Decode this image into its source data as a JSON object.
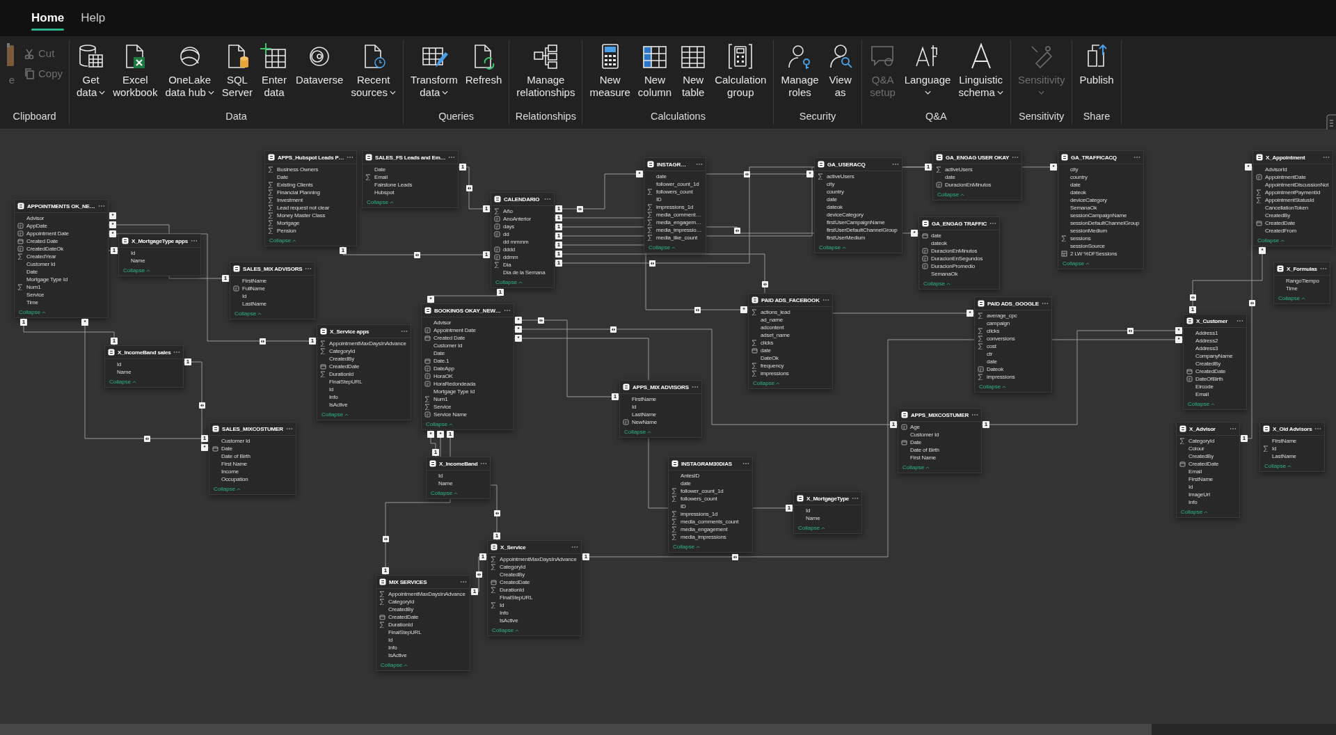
{
  "tabs": [
    {
      "label": "Home",
      "selected": true
    },
    {
      "label": "Help",
      "selected": false
    }
  ],
  "ribbon": {
    "groups": [
      {
        "label": "Clipboard",
        "buttons": [
          {
            "lines": [
              "e"
            ],
            "kind": "large",
            "dropdown": false,
            "disabled": true
          },
          {
            "lines": [
              "Cut"
            ],
            "kind": "small",
            "dropdown": false,
            "disabled": true
          },
          {
            "lines": [
              "Copy"
            ],
            "kind": "small",
            "dropdown": false,
            "disabled": true
          }
        ]
      },
      {
        "label": "Data",
        "buttons": [
          {
            "lines": [
              "Get",
              "data"
            ],
            "kind": "large",
            "dropdown": true,
            "disabled": false
          },
          {
            "lines": [
              "Excel",
              "workbook"
            ],
            "kind": "large",
            "dropdown": false,
            "disabled": false
          },
          {
            "lines": [
              "OneLake",
              "data hub"
            ],
            "kind": "large",
            "dropdown": true,
            "disabled": false
          },
          {
            "lines": [
              "SQL",
              "Server"
            ],
            "kind": "large",
            "dropdown": false,
            "disabled": false
          },
          {
            "lines": [
              "Enter",
              "data"
            ],
            "kind": "large",
            "dropdown": false,
            "disabled": false
          },
          {
            "lines": [
              "Dataverse"
            ],
            "kind": "large",
            "dropdown": false,
            "disabled": false
          },
          {
            "lines": [
              "Recent",
              "sources"
            ],
            "kind": "large",
            "dropdown": true,
            "disabled": false
          }
        ]
      },
      {
        "label": "Queries",
        "buttons": [
          {
            "lines": [
              "Transform",
              "data"
            ],
            "kind": "large",
            "dropdown": true,
            "disabled": false
          },
          {
            "lines": [
              "Refresh"
            ],
            "kind": "large",
            "dropdown": false,
            "disabled": false
          }
        ]
      },
      {
        "label": "Relationships",
        "buttons": [
          {
            "lines": [
              "Manage",
              "relationships"
            ],
            "kind": "large",
            "dropdown": false,
            "disabled": false
          }
        ]
      },
      {
        "label": "Calculations",
        "buttons": [
          {
            "lines": [
              "New",
              "measure"
            ],
            "kind": "large",
            "dropdown": false,
            "disabled": false
          },
          {
            "lines": [
              "New",
              "column"
            ],
            "kind": "large",
            "dropdown": false,
            "disabled": false
          },
          {
            "lines": [
              "New",
              "table"
            ],
            "kind": "large",
            "dropdown": false,
            "disabled": false
          },
          {
            "lines": [
              "Calculation",
              "group"
            ],
            "kind": "large",
            "dropdown": false,
            "disabled": false
          }
        ]
      },
      {
        "label": "Security",
        "buttons": [
          {
            "lines": [
              "Manage",
              "roles"
            ],
            "kind": "large",
            "dropdown": false,
            "disabled": false
          },
          {
            "lines": [
              "View",
              "as"
            ],
            "kind": "large",
            "dropdown": false,
            "disabled": false
          }
        ]
      },
      {
        "label": "Q&A",
        "buttons": [
          {
            "lines": [
              "Q&A",
              "setup"
            ],
            "kind": "large",
            "dropdown": false,
            "disabled": true
          },
          {
            "lines": [
              "Language"
            ],
            "kind": "large",
            "dropdown": true,
            "disabled": false
          },
          {
            "lines": [
              "Linguistic",
              "schema"
            ],
            "kind": "large",
            "dropdown": true,
            "disabled": false
          }
        ]
      },
      {
        "label": "Sensitivity",
        "buttons": [
          {
            "lines": [
              "Sensitivity"
            ],
            "kind": "large",
            "dropdown": true,
            "disabled": true
          }
        ]
      },
      {
        "label": "Share",
        "buttons": [
          {
            "lines": [
              "Publish"
            ],
            "kind": "large",
            "dropdown": false,
            "disabled": false
          }
        ]
      }
    ]
  },
  "model": {
    "tables": [
      {
        "name": "APPS_Hubspot Leads P…",
        "collapse_label": "Collapse",
        "fields": [
          {
            "name": "Business Owners",
            "kind": "sum"
          },
          {
            "name": "Date",
            "kind": "none"
          },
          {
            "name": "Existing Clients",
            "kind": "sum"
          },
          {
            "name": "Financial Planning",
            "kind": "sum"
          },
          {
            "name": "Investment",
            "kind": "sum"
          },
          {
            "name": "Lead request not clear",
            "kind": "sum"
          },
          {
            "name": "Money Master Class",
            "kind": "sum"
          },
          {
            "name": "Mortgage",
            "kind": "sum"
          },
          {
            "name": "Pension",
            "kind": "sum"
          }
        ]
      },
      {
        "name": "SALES_FS Leads and Em…",
        "collapse_label": "Collapse",
        "fields": [
          {
            "name": "Date",
            "kind": "none"
          },
          {
            "name": "Email",
            "kind": "sum"
          },
          {
            "name": "Fairstone Leads",
            "kind": "none"
          },
          {
            "name": "Hubspot",
            "kind": "none"
          }
        ]
      },
      {
        "name": "INSTAGR…",
        "collapse_label": "Collapse",
        "fields": [
          {
            "name": "date",
            "kind": "none"
          },
          {
            "name": "follower_count_1d",
            "kind": "none"
          },
          {
            "name": "followers_count",
            "kind": "sum"
          },
          {
            "name": "ID",
            "kind": "none"
          },
          {
            "name": "impressions_1d",
            "kind": "sum"
          },
          {
            "name": "media_comment…",
            "kind": "sum"
          },
          {
            "name": "media_engagem…",
            "kind": "sum"
          },
          {
            "name": "media_impressio…",
            "kind": "sum"
          },
          {
            "name": "media_like_count",
            "kind": "sum"
          }
        ]
      },
      {
        "name": "GA_USERACQ",
        "collapse_label": "Collapse",
        "fields": [
          {
            "name": "activeUsers",
            "kind": "sum"
          },
          {
            "name": "city",
            "kind": "none"
          },
          {
            "name": "country",
            "kind": "none"
          },
          {
            "name": "date",
            "kind": "none"
          },
          {
            "name": "dateok",
            "kind": "none"
          },
          {
            "name": "deviceCategory",
            "kind": "none"
          },
          {
            "name": "firstUserCampaignName",
            "kind": "none"
          },
          {
            "name": "firstUserDefaultChannelGroup",
            "kind": "none"
          },
          {
            "name": "firstUserMedium",
            "kind": "none"
          }
        ]
      },
      {
        "name": "GA_ENGAG USER OKAY",
        "collapse_label": "Collapse",
        "fields": [
          {
            "name": "activeUsers",
            "kind": "sum"
          },
          {
            "name": "date",
            "kind": "none"
          },
          {
            "name": "DuracionEnMinutos",
            "kind": "calc"
          }
        ]
      },
      {
        "name": "GA_TRAFFICACQ",
        "collapse_label": "Collapse",
        "fields": [
          {
            "name": "city",
            "kind": "none"
          },
          {
            "name": "country",
            "kind": "none"
          },
          {
            "name": "date",
            "kind": "none"
          },
          {
            "name": "dateok",
            "kind": "none"
          },
          {
            "name": "deviceCategory",
            "kind": "none"
          },
          {
            "name": "SemanaOk",
            "kind": "none"
          },
          {
            "name": "sessionCampaignName",
            "kind": "none"
          },
          {
            "name": "sessionDefaultChannelGroup",
            "kind": "none"
          },
          {
            "name": "sessionMedium",
            "kind": "none"
          },
          {
            "name": "sessions",
            "kind": "sum"
          },
          {
            "name": "sessionSource",
            "kind": "none"
          },
          {
            "name": "2 LW %DFSessions",
            "kind": "table"
          }
        ]
      },
      {
        "name": "X_Appointment",
        "collapse_label": "Collapse",
        "fields": [
          {
            "name": "AdvisorId",
            "kind": "none"
          },
          {
            "name": "AppointmentDate",
            "kind": "calc"
          },
          {
            "name": "AppointmentDiscussionNot",
            "kind": "none"
          },
          {
            "name": "AppointmentPaymentId",
            "kind": "sum"
          },
          {
            "name": "AppointmentStatusId",
            "kind": "sum"
          },
          {
            "name": "CancellationToken",
            "kind": "none"
          },
          {
            "name": "CreatedBy",
            "kind": "none"
          },
          {
            "name": "CreatedDate",
            "kind": "date"
          },
          {
            "name": "CreatedFrom",
            "kind": "none"
          }
        ]
      },
      {
        "name": "APPOINTMENTS OK_NE…",
        "collapse_label": "Collapse",
        "fields": [
          {
            "name": "Advisor",
            "kind": "none"
          },
          {
            "name": "AppDate",
            "kind": "calc"
          },
          {
            "name": "Appointment Date",
            "kind": "calc"
          },
          {
            "name": "Created Date",
            "kind": "date"
          },
          {
            "name": "CreatedDateOk",
            "kind": "calc"
          },
          {
            "name": "CreatedYear",
            "kind": "sum"
          },
          {
            "name": "Customer Id",
            "kind": "none"
          },
          {
            "name": "Date",
            "kind": "none"
          },
          {
            "name": "Mortgage Type Id",
            "kind": "none"
          },
          {
            "name": "Num1",
            "kind": "sum"
          },
          {
            "name": "Service",
            "kind": "none"
          },
          {
            "name": "Time",
            "kind": "none"
          }
        ]
      },
      {
        "name": "CALENDARIO",
        "collapse_label": "Collapse",
        "fields": [
          {
            "name": "Año",
            "kind": "sum"
          },
          {
            "name": "AnoAnterior",
            "kind": "calc"
          },
          {
            "name": "days",
            "kind": "calc"
          },
          {
            "name": "dd",
            "kind": "calc"
          },
          {
            "name": "dd mmmm",
            "kind": "none"
          },
          {
            "name": "dddd",
            "kind": "calc"
          },
          {
            "name": "ddmm",
            "kind": "calc"
          },
          {
            "name": "Dia",
            "kind": "sum"
          },
          {
            "name": "Dia de la Semana",
            "kind": "none"
          }
        ]
      },
      {
        "name": "X_MortgageType apps",
        "collapse_label": "Collapse",
        "fields": [
          {
            "name": "Id",
            "kind": "none"
          },
          {
            "name": "Name",
            "kind": "none"
          }
        ]
      },
      {
        "name": "SALES_MIX ADVISORS",
        "collapse_label": "Collapse",
        "fields": [
          {
            "name": "FirstName",
            "kind": "none"
          },
          {
            "name": "FullName",
            "kind": "calc"
          },
          {
            "name": "Id",
            "kind": "none"
          },
          {
            "name": "LastName",
            "kind": "none"
          }
        ]
      },
      {
        "name": "GA_ENGAG TRAFFIC",
        "collapse_label": "Collapse",
        "fields": [
          {
            "name": "date",
            "kind": "date"
          },
          {
            "name": "dateok",
            "kind": "none"
          },
          {
            "name": "DuracionEnMinutos",
            "kind": "calc"
          },
          {
            "name": "DuracionEnSegundos",
            "kind": "calc"
          },
          {
            "name": "DuracionPromedio",
            "kind": "calc"
          },
          {
            "name": "SemanaOk",
            "kind": "none"
          }
        ]
      },
      {
        "name": "PAID ADS_GOOGLE",
        "collapse_label": "Collapse",
        "fields": [
          {
            "name": "average_cpc",
            "kind": "sum"
          },
          {
            "name": "campaign",
            "kind": "none"
          },
          {
            "name": "clicks",
            "kind": "sum"
          },
          {
            "name": "conversions",
            "kind": "sum"
          },
          {
            "name": "cost",
            "kind": "sum"
          },
          {
            "name": "ctr",
            "kind": "none"
          },
          {
            "name": "date",
            "kind": "none"
          },
          {
            "name": "Dateok",
            "kind": "calc"
          },
          {
            "name": "impressions",
            "kind": "sum"
          }
        ]
      },
      {
        "name": "X_Formulas",
        "collapse_label": "Collapse",
        "fields": [
          {
            "name": "RangoTiempo",
            "kind": "none"
          },
          {
            "name": "Time",
            "kind": "none"
          }
        ]
      },
      {
        "name": "PAID ADS_FACEBOOK",
        "collapse_label": "Collapse",
        "fields": [
          {
            "name": "actions_lead",
            "kind": "sum"
          },
          {
            "name": "ad_name",
            "kind": "none"
          },
          {
            "name": "adcontent",
            "kind": "none"
          },
          {
            "name": "adset_name",
            "kind": "none"
          },
          {
            "name": "clicks",
            "kind": "sum"
          },
          {
            "name": "date",
            "kind": "date"
          },
          {
            "name": "DateOk",
            "kind": "none"
          },
          {
            "name": "frequency",
            "kind": "sum"
          },
          {
            "name": "impressions",
            "kind": "sum"
          }
        ]
      },
      {
        "name": "X_Customer",
        "collapse_label": "Collapse",
        "fields": [
          {
            "name": "Address1",
            "kind": "none"
          },
          {
            "name": "Address2",
            "kind": "none"
          },
          {
            "name": "Address3",
            "kind": "none"
          },
          {
            "name": "CompanyName",
            "kind": "none"
          },
          {
            "name": "CreatedBy",
            "kind": "none"
          },
          {
            "name": "CreatedDate",
            "kind": "date"
          },
          {
            "name": "DateOfBirth",
            "kind": "calc"
          },
          {
            "name": "Eircode",
            "kind": "none"
          },
          {
            "name": "Email",
            "kind": "none"
          }
        ]
      },
      {
        "name": "BOOKINGS OKAY_NEW…",
        "collapse_label": "Collapse",
        "fields": [
          {
            "name": "Advisor",
            "kind": "none"
          },
          {
            "name": "Appointment Date",
            "kind": "calc"
          },
          {
            "name": "Created Date",
            "kind": "date"
          },
          {
            "name": "Customer Id",
            "kind": "none"
          },
          {
            "name": "Date",
            "kind": "none"
          },
          {
            "name": "Date.1",
            "kind": "date"
          },
          {
            "name": "DateApp",
            "kind": "calc"
          },
          {
            "name": "HoraOK",
            "kind": "calc"
          },
          {
            "name": "HoraRedondeada",
            "kind": "calc"
          },
          {
            "name": "Mortgage Type Id",
            "kind": "none"
          },
          {
            "name": "Num1",
            "kind": "sum"
          },
          {
            "name": "Service",
            "kind": "sum"
          },
          {
            "name": "Service Name",
            "kind": "calc"
          }
        ]
      },
      {
        "name": "X_Service apps",
        "collapse_label": "Collapse",
        "fields": [
          {
            "name": "AppointmentMaxDaysInAdvance",
            "kind": "sum"
          },
          {
            "name": "CategoryId",
            "kind": "sum"
          },
          {
            "name": "CreatedBy",
            "kind": "none"
          },
          {
            "name": "CreatedDate",
            "kind": "date"
          },
          {
            "name": "DurationId",
            "kind": "sum"
          },
          {
            "name": "FinalStepURL",
            "kind": "none"
          },
          {
            "name": "Id",
            "kind": "none"
          },
          {
            "name": "Info",
            "kind": "none"
          },
          {
            "name": "IsActive",
            "kind": "none"
          }
        ]
      },
      {
        "name": "X_IncomeBand sales",
        "collapse_label": "Collapse",
        "fields": [
          {
            "name": "Id",
            "kind": "none"
          },
          {
            "name": "Name",
            "kind": "none"
          }
        ]
      },
      {
        "name": "APPS_MIX ADVISORS",
        "collapse_label": "Collapse",
        "fields": [
          {
            "name": "FirstName",
            "kind": "none"
          },
          {
            "name": "Id",
            "kind": "none"
          },
          {
            "name": "LastName",
            "kind": "none"
          },
          {
            "name": "NewName",
            "kind": "calc"
          }
        ]
      },
      {
        "name": "SALES_MIXCOSTUMER",
        "collapse_label": "Collapse",
        "fields": [
          {
            "name": "Customer Id",
            "kind": "none"
          },
          {
            "name": "Date",
            "kind": "date"
          },
          {
            "name": "Date of Birth",
            "kind": "none"
          },
          {
            "name": "First Name",
            "kind": "none"
          },
          {
            "name": "Income",
            "kind": "none"
          },
          {
            "name": "Occupation",
            "kind": "none"
          }
        ]
      },
      {
        "name": "APPS_MIXCOSTUMER",
        "collapse_label": "Collapse",
        "fields": [
          {
            "name": "Age",
            "kind": "calc"
          },
          {
            "name": "Customer Id",
            "kind": "none"
          },
          {
            "name": "Date",
            "kind": "date"
          },
          {
            "name": "Date of Birth",
            "kind": "none"
          },
          {
            "name": "First Name",
            "kind": "none"
          }
        ]
      },
      {
        "name": "X_Advisor",
        "collapse_label": "Collapse",
        "fields": [
          {
            "name": "CategoryId",
            "kind": "sum"
          },
          {
            "name": "Colour",
            "kind": "none"
          },
          {
            "name": "CreatedBy",
            "kind": "none"
          },
          {
            "name": "CreatedDate",
            "kind": "date"
          },
          {
            "name": "Email",
            "kind": "none"
          },
          {
            "name": "FirstName",
            "kind": "none"
          },
          {
            "name": "Id",
            "kind": "none"
          },
          {
            "name": "ImageUrl",
            "kind": "none"
          },
          {
            "name": "Info",
            "kind": "none"
          }
        ]
      },
      {
        "name": "X_Old Advisors",
        "collapse_label": "Collapse",
        "fields": [
          {
            "name": "FirstName",
            "kind": "none"
          },
          {
            "name": "Id",
            "kind": "sum"
          },
          {
            "name": "LastName",
            "kind": "none"
          }
        ]
      },
      {
        "name": "X_IncomeBand",
        "collapse_label": "Collapse",
        "fields": [
          {
            "name": "Id",
            "kind": "none"
          },
          {
            "name": "Name",
            "kind": "none"
          }
        ]
      },
      {
        "name": "INSTAGRAM30DIAS",
        "collapse_label": "Collapse",
        "fields": [
          {
            "name": "AntesID",
            "kind": "none"
          },
          {
            "name": "date",
            "kind": "none"
          },
          {
            "name": "follower_count_1d",
            "kind": "sum"
          },
          {
            "name": "followers_count",
            "kind": "sum"
          },
          {
            "name": "ID",
            "kind": "none"
          },
          {
            "name": "impressions_1d",
            "kind": "sum"
          },
          {
            "name": "media_comments_count",
            "kind": "sum"
          },
          {
            "name": "media_engagement",
            "kind": "sum"
          },
          {
            "name": "media_impressions",
            "kind": "sum"
          }
        ]
      },
      {
        "name": "X_MortgageType",
        "collapse_label": "Collapse",
        "fields": [
          {
            "name": "Id",
            "kind": "none"
          },
          {
            "name": "Name",
            "kind": "none"
          }
        ]
      },
      {
        "name": "X_Service",
        "collapse_label": "Collapse",
        "fields": [
          {
            "name": "AppointmentMaxDaysInAdvance",
            "kind": "sum"
          },
          {
            "name": "CategoryId",
            "kind": "sum"
          },
          {
            "name": "CreatedBy",
            "kind": "none"
          },
          {
            "name": "CreatedDate",
            "kind": "date"
          },
          {
            "name": "DurationId",
            "kind": "sum"
          },
          {
            "name": "FinalStepURL",
            "kind": "none"
          },
          {
            "name": "Id",
            "kind": "sum"
          },
          {
            "name": "Info",
            "kind": "none"
          },
          {
            "name": "IsActive",
            "kind": "none"
          }
        ]
      },
      {
        "name": "MIX SERVICES",
        "collapse_label": "Collapse",
        "fields": [
          {
            "name": "AppointmentMaxDaysInAdvance",
            "kind": "sum"
          },
          {
            "name": "CategoryId",
            "kind": "sum"
          },
          {
            "name": "CreatedBy",
            "kind": "none"
          },
          {
            "name": "CreatedDate",
            "kind": "date"
          },
          {
            "name": "DurationId",
            "kind": "sum"
          },
          {
            "name": "FinalStepURL",
            "kind": "none"
          },
          {
            "name": "Id",
            "kind": "none"
          },
          {
            "name": "Info",
            "kind": "none"
          },
          {
            "name": "IsActive",
            "kind": "none"
          }
        ]
      }
    ],
    "relationships": [
      {
        "from_end": "*",
        "to_end": "1"
      },
      {
        "from_end": "*",
        "to_end": "1"
      },
      {
        "from_end": "1",
        "to_end": "1"
      },
      {
        "from_end": "*",
        "to_end": "1"
      },
      {
        "from_end": "*",
        "to_end": "1"
      },
      {
        "from_end": "1",
        "to_end": "*"
      },
      {
        "from_end": "1",
        "to_end": "1"
      },
      {
        "from_end": "1",
        "to_end": "1"
      },
      {
        "from_end": "1",
        "to_end": "*"
      },
      {
        "from_end": "1",
        "to_end": "*"
      },
      {
        "from_end": "1",
        "to_end": "*"
      },
      {
        "from_end": "1",
        "to_end": "*"
      },
      {
        "from_end": "1",
        "to_end": "*"
      },
      {
        "from_end": "1",
        "to_end": "*"
      },
      {
        "from_end": "1",
        "to_end": "1"
      },
      {
        "from_end": "1",
        "to_end": "*"
      },
      {
        "from_end": "*",
        "to_end": "1"
      },
      {
        "from_end": "*",
        "to_end": "1"
      },
      {
        "from_end": "*",
        "to_end": "1"
      },
      {
        "from_end": "1",
        "to_end": "1"
      },
      {
        "from_end": "*",
        "to_end": "1"
      },
      {
        "from_end": "*",
        "to_end": "1"
      },
      {
        "from_end": "1",
        "to_end": "*"
      },
      {
        "from_end": "1",
        "to_end": "*"
      },
      {
        "from_end": "1",
        "to_end": "*"
      },
      {
        "from_end": "1",
        "to_end": "1"
      },
      {
        "from_end": "1",
        "to_end": "*"
      }
    ]
  }
}
